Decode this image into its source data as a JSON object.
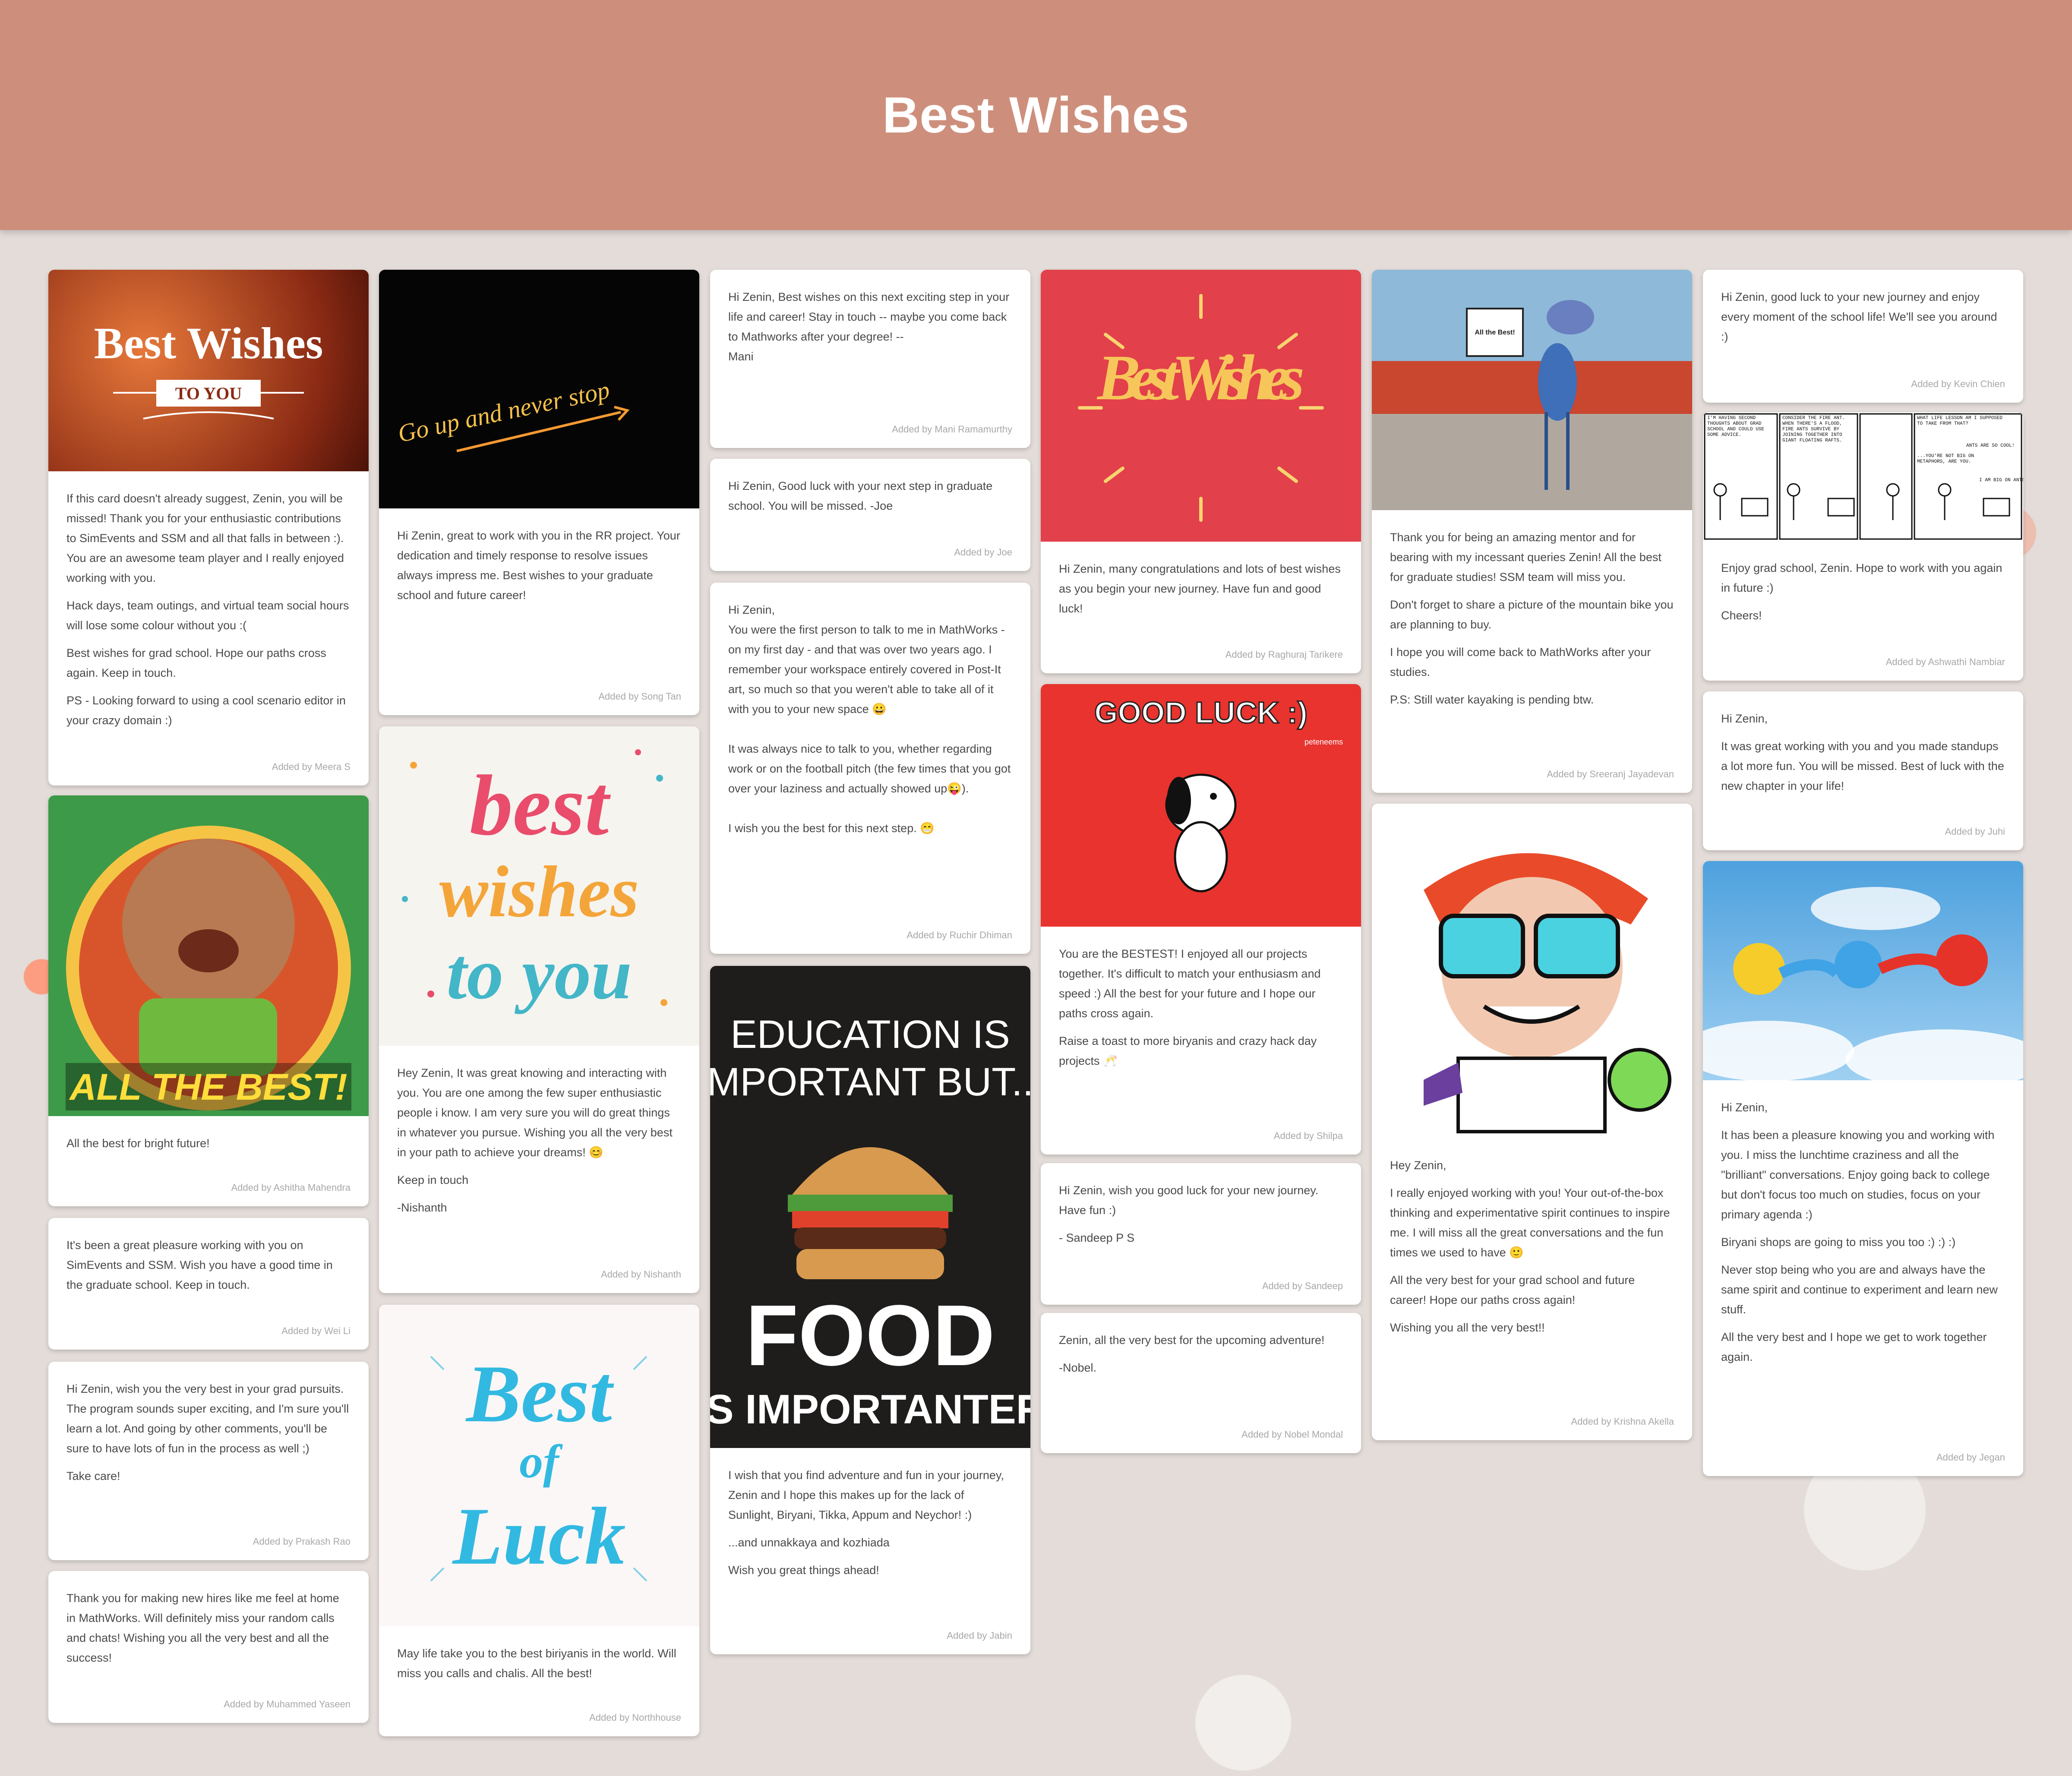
{
  "board": {
    "title": "Best Wishes"
  },
  "images": {
    "bw_title": "Best Wishes",
    "bw_sub": "TO YOU",
    "neon": "Go up and never stop",
    "bestwishes_script": "Best Wishes",
    "roadrunner_sign": "All the Best!",
    "allthebest": "ALL THE BEST!",
    "bwty_1": "best",
    "bwty_2": "wishes",
    "bwty_3": "to you",
    "goodluck": "GOOD LUCK :)",
    "goodluck_credit": "peteneems",
    "bol_1": "Best",
    "bol_2": "of",
    "bol_3": "Luck",
    "food_1": "EDUCATION IS",
    "food_2": "IMPORTANT BUT...",
    "food_3": "FOOD",
    "food_4": "IS IMPORTANTER",
    "comic_1": "I'M HAVING SECOND THOUGHTS ABOUT GRAD SCHOOL AND COULD USE SOME ADVICE.",
    "comic_2": "CONSIDER THE FIRE ANT. WHEN THERE'S A FLOOD, FIRE ANTS SURVIVE BY JOINING TOGETHER INTO GIANT FLOATING RAFTS.",
    "comic_3": "WHAT LIFE LESSON AM I SUPPOSED TO TAKE FROM THAT?",
    "comic_4": "ANTS ARE SO COOL!",
    "comic_5": "...YOU'RE NOT BIG ON METAPHORS, ARE YOU.",
    "comic_6": "I AM BIG ON ANTS."
  },
  "cards": {
    "meera": {
      "p1": "If this card doesn't already suggest, Zenin, you will be missed! Thank you for your enthusiastic contributions to SimEvents and SSM and all that falls in between :). You are an awesome team player and I really enjoyed working with you.",
      "p2": "Hack days, team outings, and virtual team social hours will lose some colour without you :(",
      "p3": "Best wishes for grad school. Hope our paths cross again. Keep in touch.",
      "p4": "PS - Looking forward to using a cool scenario editor in your crazy domain :)",
      "author": "Added by Meera S"
    },
    "ashitha": {
      "p1": "All the best for bright future!",
      "author": "Added by Ashitha Mahendra"
    },
    "weili": {
      "p1": "It's been a great pleasure working with you on SimEvents and SSM. Wish you have a good time in the graduate school. Keep in touch.",
      "author": "Added by Wei Li"
    },
    "prakash": {
      "p1": "Hi Zenin, wish you the very best in your grad pursuits. The program sounds super exciting, and I'm sure you'll learn a lot. And going by other comments, you'll be sure to have lots of fun in the process as well ;)",
      "p2": "Take care!",
      "author": "Added by Prakash Rao"
    },
    "yaseen": {
      "p1": "Thank you for making new hires like me feel at home in MathWorks. Will definitely miss your random calls and chats! Wishing you all the very best and all the success!",
      "author": "Added by Muhammed Yaseen"
    },
    "song": {
      "p1": "Hi Zenin, great to work with you in the RR project. Your dedication  and timely response to resolve issues always impress me. Best wishes to your graduate school and future career!",
      "author": "Added by Song Tan"
    },
    "nishanth": {
      "p1": "Hey Zenin, It was great knowing and interacting with you. You are one among the few super enthusiastic people i know. I am very sure you will do great things in whatever you pursue. Wishing you all the very best in your path to achieve your dreams! 😊",
      "p2": "Keep in touch",
      "p3": "-Nishanth",
      "author": "Added by Nishanth"
    },
    "northhouse": {
      "p1": "May life take you to the best biriyanis in the world. Will miss you calls and chalis. All the best!",
      "author": "Added by Northhouse"
    },
    "mani": {
      "p1": "Hi Zenin, Best wishes on this next exciting step in your life and career! Stay in touch -- maybe you come back to Mathworks after your degree! --\nMani",
      "author": "Added by Mani Ramamurthy"
    },
    "joe": {
      "p1": "Hi Zenin, Good luck with your next step in graduate school. You will be missed. -Joe",
      "author": "Added by Joe"
    },
    "ruchir": {
      "p1": "Hi Zenin,\nYou were the first person to talk to me in MathWorks - on my first day - and that was over two years ago. I remember your workspace entirely covered in Post-It art, so much so that you weren't able to take all of it with you to your new space 😀",
      "p2": "It was always nice to talk to you, whether regarding work or on the football pitch (the few times that you got over your laziness and actually showed up😜).",
      "p3": "I wish you the best for this next step.  😁",
      "author": "Added by Ruchir Dhiman"
    },
    "jabin": {
      "p1": "I wish that you find adventure and fun in your journey, Zenin and I hope this makes up for the lack of Sunlight, Biryani, Tikka, Appum and Neychor! :)",
      "p2": "...and unnakkaya and kozhiada",
      "p3": "Wish you great things ahead!",
      "author": "Added by Jabin"
    },
    "raghuraj": {
      "p1": "Hi Zenin, many congratulations and lots of best wishes as you begin your new journey. Have fun and good luck!",
      "author": "Added by Raghuraj Tarikere"
    },
    "shilpa": {
      "p1": "You are the BESTEST! I enjoyed all our projects together. It's difficult to match your enthusiasm and speed :) All the best for your future and I hope our paths cross again.",
      "p2": "Raise a toast to more biryanis and crazy hack day projects  🥂",
      "author": "Added by Shilpa"
    },
    "sandeep": {
      "p1": "Hi Zenin, wish you good luck for your new journey. Have fun :)",
      "p2": "- Sandeep P S",
      "author": "Added by Sandeep"
    },
    "nobel": {
      "p1": "Zenin, all the very best for the upcoming adventure!",
      "p2": "-Nobel.",
      "author": "Added by Nobel Mondal"
    },
    "sreeranj": {
      "p1": "Thank you for being an amazing mentor and for bearing with my incessant queries Zenin! All the best for graduate studies! SSM team will miss you.",
      "p2": "Don't forget to share a picture of the mountain bike you are planning to buy.",
      "p3": "I hope you will come back to MathWorks after your studies.",
      "p4": "P.S: Still water kayaking is pending btw.",
      "author": "Added by Sreeranj Jayadevan"
    },
    "krishna": {
      "p1": "Hey Zenin,",
      "p2": "I really enjoyed working with you! Your out-of-the-box thinking and experimentative spirit continues to inspire me. I will miss all the great conversations and the fun times we used to have 🙂",
      "p3": "All the very best for your grad school and future career! Hope our paths cross again!",
      "p4": "Wishing you all the very best!!",
      "author": "Added by Krishna Akella"
    },
    "kevin": {
      "p1": "Hi Zenin, good luck to your new journey and enjoy every moment of the school life!  We'll see you around :)",
      "author": "Added by Kevin Chien"
    },
    "ashwathi": {
      "p1": "Enjoy grad school, Zenin. Hope to work with you again in future :)",
      "p2": "Cheers!",
      "author": "Added by Ashwathi Nambiar"
    },
    "juhi": {
      "p1": "Hi Zenin,",
      "p2": "It was great working with you and you made standups a lot more fun. You will be missed. Best of luck with the new chapter in your life!",
      "author": "Added by Juhi"
    },
    "jegan": {
      "p1": "Hi Zenin,",
      "p2": "It has been a pleasure knowing you and working with you. I miss the lunchtime craziness and all the \"brilliant\" conversations. Enjoy going back to college but don't focus too much on studies, focus on your primary agenda :)",
      "p3": "Biryani shops are going to miss you too :) :) :)",
      "p4": "Never stop being who you are and always have the same spirit and continue to experiment and learn new stuff.",
      "p5": "All the very best and I hope we get to work together again.",
      "author": "Added by Jegan"
    }
  },
  "colors": {
    "header": "#cd8f7c",
    "card_text": "#4a4a4a",
    "author_text": "#a8a8a8"
  }
}
